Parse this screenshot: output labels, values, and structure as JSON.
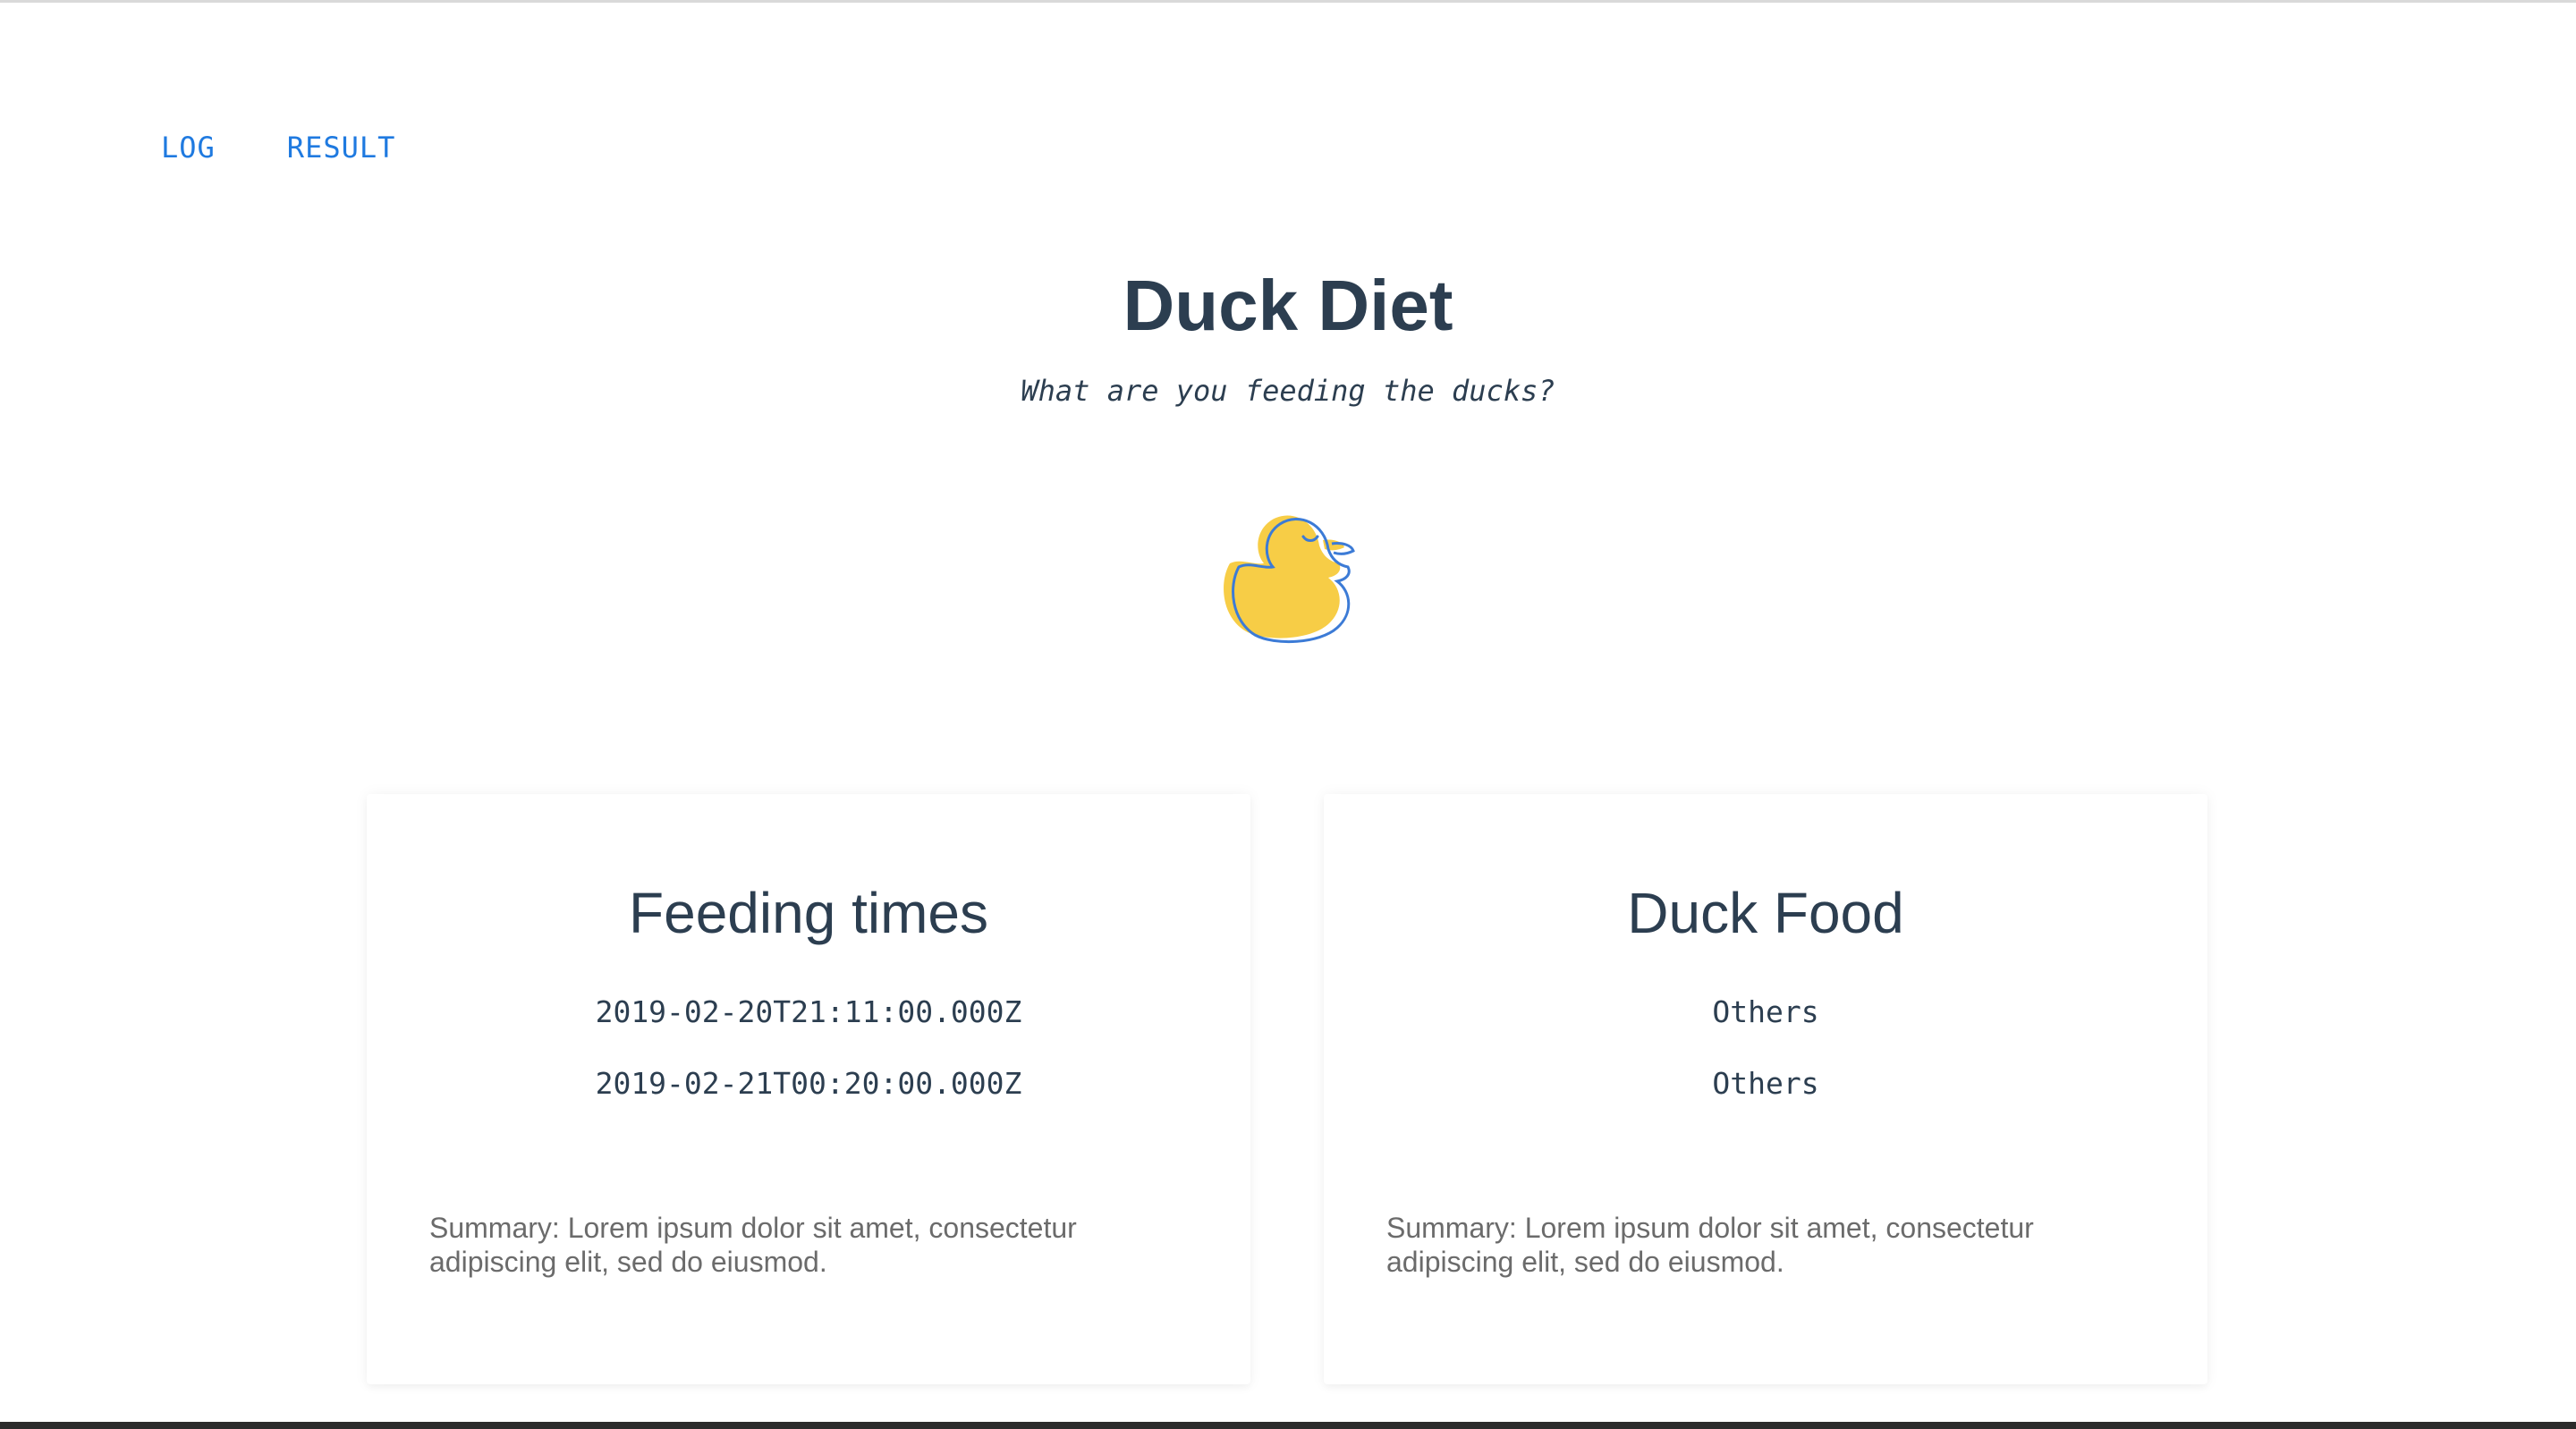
{
  "nav": {
    "items": [
      {
        "label": "LOG"
      },
      {
        "label": "RESULT"
      }
    ]
  },
  "header": {
    "title": "Duck Diet",
    "subtitle": "What are you feeding the ducks?"
  },
  "colors": {
    "accent": "#1f7ae0",
    "heading": "#2c3e50",
    "duck_fill": "#f7cd46",
    "duck_outline": "#3c7bd6",
    "summary_text": "#6b6b6b"
  },
  "logo": {
    "icon": "rubber-duck-icon"
  },
  "cards": [
    {
      "title": "Feeding times",
      "items": [
        "2019-02-20T21:11:00.000Z",
        "2019-02-21T00:20:00.000Z"
      ],
      "summary": "Summary: Lorem ipsum dolor sit amet, consectetur adipiscing elit, sed do eiusmod."
    },
    {
      "title": "Duck Food",
      "items": [
        "Others",
        "Others"
      ],
      "summary": "Summary: Lorem ipsum dolor sit amet, consectetur adipiscing elit, sed do eiusmod."
    }
  ]
}
